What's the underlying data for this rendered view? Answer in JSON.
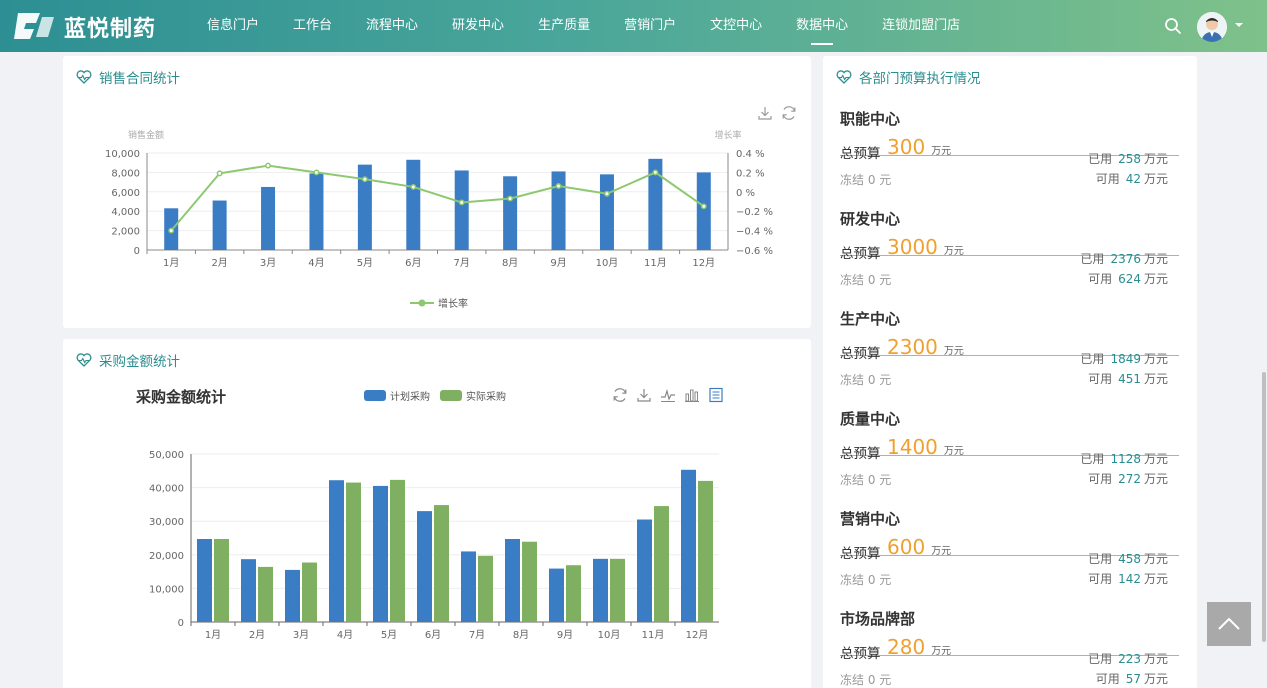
{
  "header": {
    "brand": "蓝悦制药",
    "nav": [
      "信息门户",
      "工作台",
      "流程中心",
      "研发中心",
      "生产质量",
      "营销门户",
      "文控中心",
      "数据中心",
      "连锁加盟门店"
    ],
    "active_nav": "数据中心"
  },
  "sales_panel": {
    "title": "销售合同统计",
    "legend": "增长率",
    "chart_data": {
      "type": "bar",
      "categories": [
        "1月",
        "2月",
        "3月",
        "4月",
        "5月",
        "6月",
        "7月",
        "8月",
        "9月",
        "10月",
        "11月",
        "12月"
      ],
      "y_left_label": "销售金额",
      "y_right_label": "增长率",
      "y_left_ticks": [
        "10,000",
        "8,000",
        "6,000",
        "4,000",
        "2,000",
        "0"
      ],
      "y_right_ticks": [
        "0.4 %",
        "0.2 %",
        "0 %",
        "−0.2 %",
        "−0.4 %",
        "−0.6 %"
      ],
      "ylim_left": [
        0,
        10000
      ],
      "ylim_right": [
        -0.6,
        0.4
      ],
      "series": [
        {
          "name": "销售金额",
          "type": "bar",
          "values": [
            4300,
            5100,
            6500,
            7900,
            8800,
            9300,
            8200,
            7600,
            8100,
            7800,
            9400,
            8000
          ]
        },
        {
          "name": "增长率",
          "type": "line",
          "values": [
            -0.4,
            0.19,
            0.27,
            0.2,
            0.13,
            0.05,
            -0.11,
            -0.07,
            0.06,
            -0.02,
            0.2,
            -0.15
          ]
        }
      ]
    }
  },
  "purchase_panel": {
    "title": "采购金额统计",
    "chart_title": "采购金额统计",
    "legend": [
      "计划采购",
      "实际采购"
    ],
    "chart_data": {
      "type": "bar",
      "categories": [
        "1月",
        "2月",
        "3月",
        "4月",
        "5月",
        "6月",
        "7月",
        "8月",
        "9月",
        "10月",
        "11月",
        "12月"
      ],
      "y_ticks": [
        "50,000",
        "40,000",
        "30,000",
        "20,000",
        "10,000",
        "0"
      ],
      "ylim": [
        0,
        50000
      ],
      "series": [
        {
          "name": "计划采购",
          "values": [
            24700,
            18700,
            15500,
            42200,
            40500,
            33000,
            21000,
            24700,
            15900,
            18800,
            30500,
            45300
          ]
        },
        {
          "name": "实际采购",
          "values": [
            24700,
            16400,
            17700,
            41500,
            42300,
            34800,
            19700,
            23900,
            16900,
            18800,
            34500,
            42000
          ]
        }
      ]
    }
  },
  "budget_panel": {
    "title": "各部门预算执行情况",
    "total_label": "总预算",
    "unit": "万元",
    "frozen_label": "冻结 0 元",
    "used_label": "已用",
    "avail_label": "可用",
    "departments": [
      {
        "name": "职能中心",
        "total": "300",
        "used": "258",
        "avail": "42"
      },
      {
        "name": "研发中心",
        "total": "3000",
        "used": "2376",
        "avail": "624"
      },
      {
        "name": "生产中心",
        "total": "2300",
        "used": "1849",
        "avail": "451"
      },
      {
        "name": "质量中心",
        "total": "1400",
        "used": "1128",
        "avail": "272"
      },
      {
        "name": "营销中心",
        "total": "600",
        "used": "458",
        "avail": "142"
      },
      {
        "name": "市场品牌部",
        "total": "280",
        "used": "223",
        "avail": "57"
      }
    ]
  },
  "colors": {
    "bar_blue": "#3b7dc4",
    "bar_green": "#7fb061",
    "line_green": "#8dc870",
    "accent_teal": "#2c8d8f",
    "accent_orange": "#f0a030"
  }
}
